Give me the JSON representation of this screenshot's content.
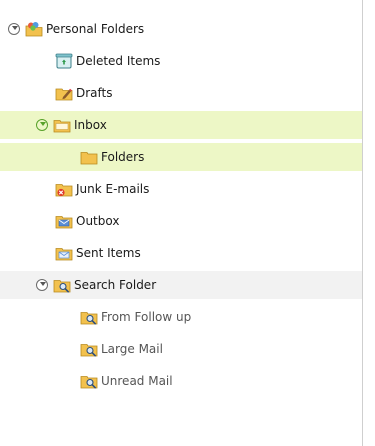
{
  "tree": {
    "root": {
      "label": "Personal Folders",
      "icon": "personal-folders-icon"
    },
    "items": {
      "deleted": {
        "label": "Deleted Items",
        "icon": "recycle-bin-icon"
      },
      "drafts": {
        "label": "Drafts",
        "icon": "drafts-folder-icon"
      },
      "inbox": {
        "label": "Inbox",
        "icon": "folder-icon"
      },
      "folders": {
        "label": "Folders",
        "icon": "folder-icon"
      },
      "junk": {
        "label": "Junk E-mails",
        "icon": "junk-folder-icon"
      },
      "outbox": {
        "label": "Outbox",
        "icon": "outbox-folder-icon"
      },
      "sent": {
        "label": "Sent Items",
        "icon": "sent-folder-icon"
      }
    },
    "search": {
      "label": "Search Folder",
      "icon": "search-folder-icon",
      "children": {
        "followup": {
          "label": "From Follow up",
          "icon": "search-folder-icon"
        },
        "large": {
          "label": "Large Mail",
          "icon": "search-folder-icon"
        },
        "unread": {
          "label": "Unread Mail",
          "icon": "search-folder-icon"
        }
      }
    },
    "colors": {
      "selected_bg": "#edf7c6",
      "group_bg": "#f2f2f2",
      "folder": "#f2c14e"
    }
  }
}
